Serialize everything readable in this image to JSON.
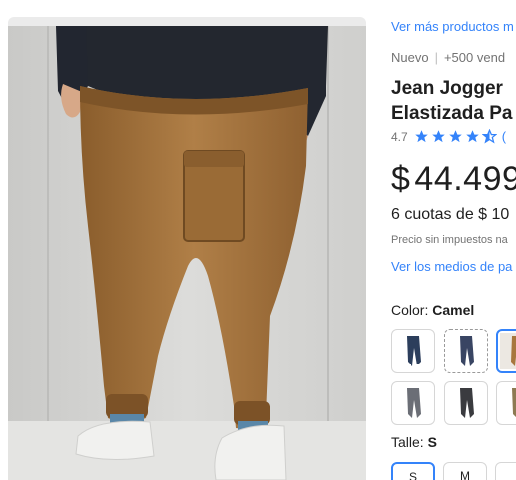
{
  "links": {
    "more_products": "Ver más productos m",
    "payment_methods": "Ver los medios de pa"
  },
  "product": {
    "condition": "Nuevo",
    "sold": "+500 vend",
    "title_line1": "Jean Jogger",
    "title_line2": "Elastizada Pa",
    "rating_value": "4.7",
    "rating_stars": 4.5,
    "rating_count": "(",
    "price_currency": "$",
    "price_amount": "44.499",
    "installments": "6 cuotas de $ 10",
    "tax_note": "Precio sin impuestos na"
  },
  "color": {
    "label": "Color:",
    "selected": "Camel"
  },
  "size": {
    "label": "Talle:",
    "selected": "S",
    "options": [
      "S",
      "M",
      ""
    ]
  },
  "colors": {
    "accent": "#3483fa",
    "star": "#3483fa",
    "text": "#1f1f1f",
    "muted": "#737373",
    "camel": "#a8773e"
  }
}
